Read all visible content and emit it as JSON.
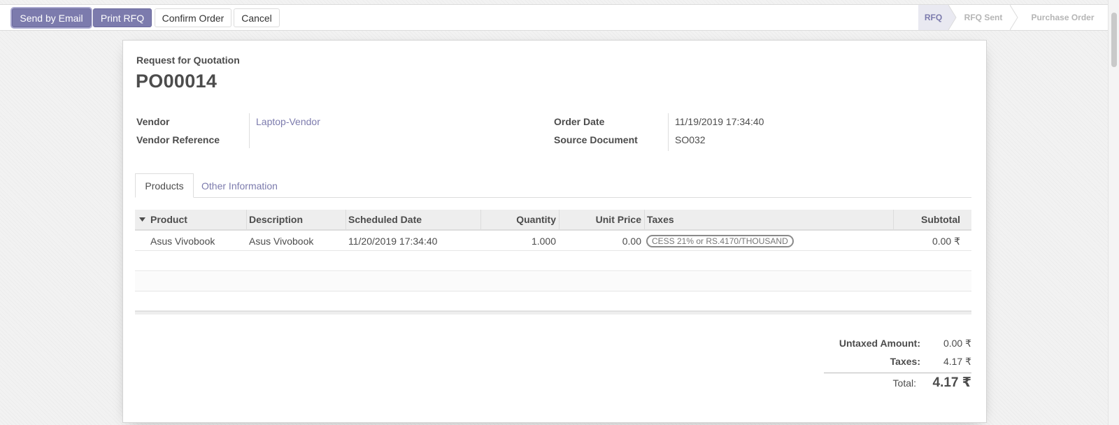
{
  "toolbar": {
    "send_email": "Send by Email",
    "print_rfq": "Print RFQ",
    "confirm_order": "Confirm Order",
    "cancel": "Cancel"
  },
  "statusbar": {
    "stages": [
      "RFQ",
      "RFQ Sent",
      "Purchase Order"
    ],
    "active": "RFQ"
  },
  "form": {
    "doc_type": "Request for Quotation",
    "name": "PO00014",
    "vendor_label": "Vendor",
    "vendor_value": "Laptop-Vendor",
    "vendor_ref_label": "Vendor Reference",
    "vendor_ref_value": "",
    "order_date_label": "Order Date",
    "order_date_value": "11/19/2019 17:34:40",
    "source_doc_label": "Source Document",
    "source_doc_value": "SO032"
  },
  "tabs": [
    "Products",
    "Other Information"
  ],
  "lines": {
    "columns": [
      "Product",
      "Description",
      "Scheduled Date",
      "Quantity",
      "Unit Price",
      "Taxes",
      "Subtotal"
    ],
    "rows": [
      {
        "product": "Asus Vivobook",
        "description": "Asus Vivobook",
        "scheduled_date": "11/20/2019 17:34:40",
        "quantity": "1.000",
        "unit_price": "0.00",
        "taxes": "CESS 21% or RS.4170/THOUSAND",
        "subtotal": "0.00 ₹"
      }
    ]
  },
  "totals": {
    "untaxed_label": "Untaxed Amount:",
    "untaxed_value": "0.00 ₹",
    "taxes_label": "Taxes:",
    "taxes_value": "4.17 ₹",
    "total_label": "Total:",
    "total_value": "4.17 ₹"
  },
  "colors": {
    "primary": "#7c7bad",
    "text": "#4c4c4c",
    "muted": "#b5b5b5"
  }
}
